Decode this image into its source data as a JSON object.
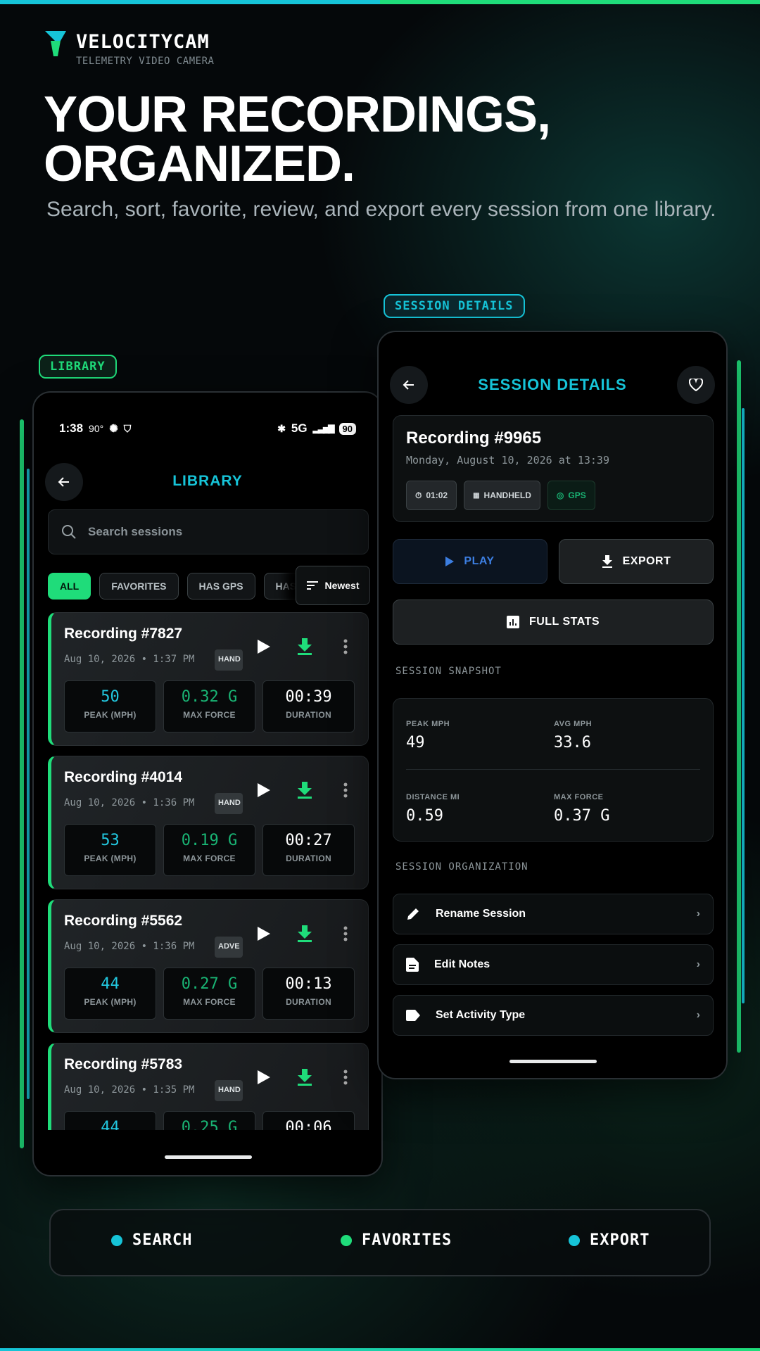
{
  "brand": {
    "name": "VELOCITYCAM",
    "tagline": "TELEMETRY VIDEO CAMERA"
  },
  "hero": {
    "headline_line1": "YOUR RECORDINGS,",
    "headline_line2": "ORGANIZED.",
    "subhead": "Search, sort, favorite, review, and export every session from one library."
  },
  "labels": {
    "library": "LIBRARY",
    "session_details": "SESSION DETAILS"
  },
  "colors": {
    "accent_cyan": "#16c4d8",
    "accent_green": "#1fdc7a",
    "play_blue": "#3c7ee0"
  },
  "status_bar": {
    "time": "1:38",
    "temp": "90°",
    "network": "5G",
    "battery": "90"
  },
  "library": {
    "title": "LIBRARY",
    "search_placeholder": "Search sessions",
    "filters": [
      "ALL",
      "FAVORITES",
      "HAS GPS",
      "HAS"
    ],
    "active_filter": "ALL",
    "sort_label": "Newest",
    "stat_labels": {
      "peak": "PEAK (MPH)",
      "force": "MAX FORCE",
      "duration": "DURATION"
    },
    "recordings": [
      {
        "title": "Recording #7827",
        "date": "Aug 10, 2026 • 1:37 PM",
        "tag": "HAND",
        "peak": "50",
        "force": "0.32 G",
        "duration": "00:39"
      },
      {
        "title": "Recording #4014",
        "date": "Aug 10, 2026 • 1:36 PM",
        "tag": "HAND",
        "peak": "53",
        "force": "0.19 G",
        "duration": "00:27"
      },
      {
        "title": "Recording #5562",
        "date": "Aug 10, 2026 • 1:36 PM",
        "tag": "ADVE",
        "peak": "44",
        "force": "0.27 G",
        "duration": "00:13"
      },
      {
        "title": "Recording #5783",
        "date": "Aug 10, 2026 • 1:35 PM",
        "tag": "HAND",
        "peak": "44",
        "force": "0.25 G",
        "duration": "00:06"
      }
    ]
  },
  "session": {
    "title": "SESSION DETAILS",
    "recording_title": "Recording #9965",
    "recording_date": "Monday, August 10, 2026 at 13:39",
    "chips": {
      "duration": "01:02",
      "mode": "HANDHELD",
      "gps": "GPS"
    },
    "play_label": "PLAY",
    "export_label": "EXPORT",
    "stats_label": "FULL STATS",
    "snapshot_label": "SESSION SNAPSHOT",
    "snapshot": {
      "peak_label": "PEAK MPH",
      "peak_value": "49",
      "avg_label": "AVG MPH",
      "avg_value": "33.6",
      "dist_label": "DISTANCE MI",
      "dist_value": "0.59",
      "force_label": "MAX FORCE",
      "force_value": "0.37 G"
    },
    "organization_label": "SESSION ORGANIZATION",
    "organization": [
      "Rename Session",
      "Edit Notes",
      "Set Activity Type"
    ]
  },
  "features": [
    "SEARCH",
    "FAVORITES",
    "EXPORT"
  ]
}
